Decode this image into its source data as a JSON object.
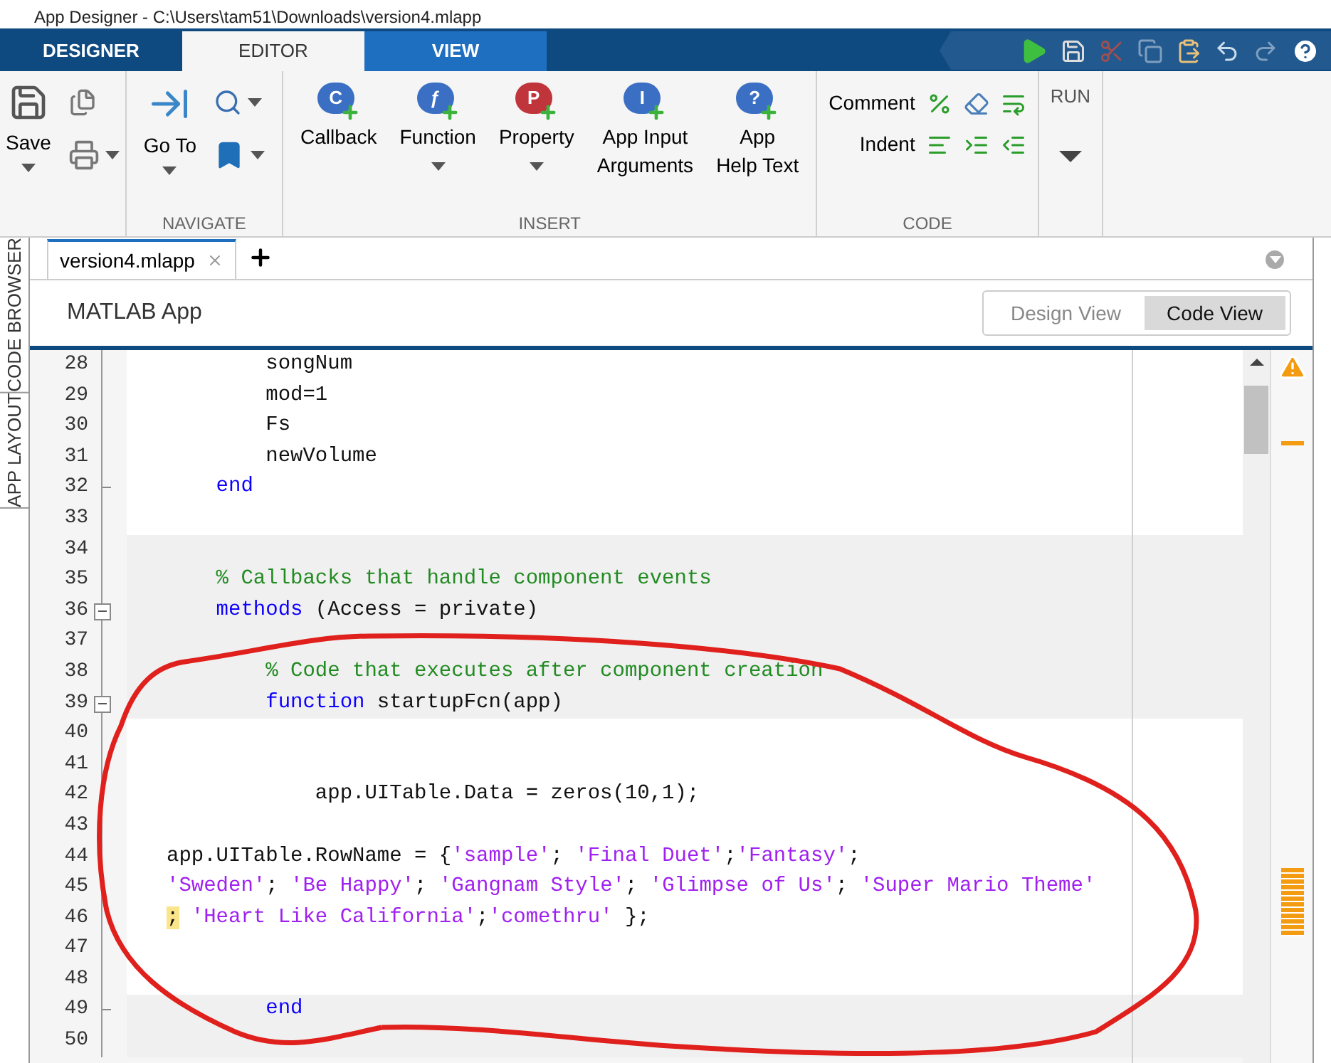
{
  "window": {
    "title": "App Designer - C:\\Users\\tam51\\Downloads\\version4.mlapp"
  },
  "ribbon_tabs": [
    {
      "label": "DESIGNER",
      "selected": false
    },
    {
      "label": "EDITOR",
      "selected": true
    },
    {
      "label": "VIEW",
      "selected": false
    }
  ],
  "ribbon_groups": [
    {
      "kind": "file",
      "buttons": [
        {
          "label": "Save",
          "dropdown": true
        }
      ]
    },
    {
      "kind": "navigate",
      "label": "NAVIGATE",
      "buttons": [
        {
          "label": "Go To",
          "dropdown": true
        }
      ]
    },
    {
      "kind": "insert",
      "label": "INSERT",
      "buttons": [
        {
          "label": "Callback",
          "glyph": "C",
          "color": "#3b6fc4",
          "dropdown": false
        },
        {
          "label": "Function",
          "glyph": "ƒ",
          "color": "#3b6fc4",
          "dropdown": true
        },
        {
          "label": "Property",
          "glyph": "P",
          "color": "#c0343c",
          "dropdown": true
        },
        {
          "label": "App Input\nArguments",
          "glyph": "I",
          "color": "#3b6fc4",
          "dropdown": false
        },
        {
          "label": "App\nHelp Text",
          "glyph": "?",
          "color": "#3b6fc4",
          "dropdown": false
        }
      ]
    },
    {
      "kind": "code",
      "label": "CODE",
      "buttons": [
        {
          "label": "Comment"
        },
        {
          "label": "Indent"
        }
      ]
    },
    {
      "kind": "run",
      "buttons": [
        {
          "label": "RUN",
          "dropdown": true
        }
      ]
    }
  ],
  "document_tabs": [
    {
      "label": "version4.mlapp",
      "selected": true
    }
  ],
  "header": {
    "title": "MATLAB App",
    "views": [
      {
        "label": "Design View",
        "selected": false
      },
      {
        "label": "Code View",
        "selected": true
      }
    ]
  },
  "side_tabs": [
    "CODE BROWSER",
    "APP LAYOUT"
  ],
  "code_lines": [
    {
      "n": "28",
      "editable": true,
      "segments": [
        {
          "kind": "plain",
          "text": "        songNum"
        }
      ]
    },
    {
      "n": "29",
      "editable": true,
      "segments": [
        {
          "kind": "plain",
          "text": "        mod=1"
        }
      ]
    },
    {
      "n": "30",
      "editable": true,
      "segments": [
        {
          "kind": "plain",
          "text": "        Fs"
        }
      ]
    },
    {
      "n": "31",
      "editable": true,
      "segments": [
        {
          "kind": "plain",
          "text": "        newVolume"
        }
      ]
    },
    {
      "n": "32",
      "editable": true,
      "kind": "fold_end",
      "segments": [
        {
          "kind": "keyword",
          "text": "    end"
        }
      ]
    },
    {
      "n": "33",
      "editable": true
    },
    {
      "n": "34",
      "editable": false
    },
    {
      "n": "35",
      "editable": false,
      "segments": [
        {
          "kind": "comment",
          "text": "    % Callbacks that handle component events"
        }
      ]
    },
    {
      "n": "36",
      "editable": false,
      "kind": "fold_start",
      "segments": [
        {
          "kind": "keyword",
          "text": "    methods"
        },
        {
          "kind": "plain",
          "text": " (Access = private)"
        }
      ]
    },
    {
      "n": "37",
      "editable": false
    },
    {
      "n": "38",
      "editable": false,
      "segments": [
        {
          "kind": "comment",
          "text": "        % Code that executes after component creation"
        }
      ]
    },
    {
      "n": "39",
      "editable": false,
      "kind": "fold_start",
      "segments": [
        {
          "kind": "keyword",
          "text": "        function"
        },
        {
          "kind": "plain",
          "text": " startupFcn(app)"
        }
      ]
    },
    {
      "n": "40",
      "editable": true
    },
    {
      "n": "41",
      "editable": true
    },
    {
      "n": "42",
      "editable": true,
      "segments": [
        {
          "kind": "plain",
          "text": "            app.UITable.Data = zeros(10,1);"
        }
      ]
    },
    {
      "n": "43",
      "editable": true
    },
    {
      "n": "44",
      "editable": true,
      "segments": [
        {
          "kind": "plain",
          "text": "app.UITable.RowName = {"
        },
        {
          "kind": "string",
          "text": "'sample'"
        },
        {
          "kind": "plain",
          "text": "; "
        },
        {
          "kind": "string",
          "text": "'Final Duet'"
        },
        {
          "kind": "plain",
          "text": ";"
        },
        {
          "kind": "string",
          "text": "'Fantasy'"
        },
        {
          "kind": "plain",
          "text": ";"
        }
      ]
    },
    {
      "n": "45",
      "editable": true,
      "segments": [
        {
          "kind": "string",
          "text": "'Sweden'"
        },
        {
          "kind": "plain",
          "text": "; "
        },
        {
          "kind": "string",
          "text": "'Be Happy'"
        },
        {
          "kind": "plain",
          "text": "; "
        },
        {
          "kind": "string",
          "text": "'Gangnam Style'"
        },
        {
          "kind": "plain",
          "text": "; "
        },
        {
          "kind": "string",
          "text": "'Glimpse of Us'"
        },
        {
          "kind": "plain",
          "text": "; "
        },
        {
          "kind": "string",
          "text": "'Super Mario Theme'"
        }
      ]
    },
    {
      "n": "46",
      "editable": true,
      "segments": [
        {
          "kind": "marked",
          "text": ";"
        },
        {
          "kind": "string",
          "text": " 'Heart Like California'"
        },
        {
          "kind": "plain",
          "text": ";"
        },
        {
          "kind": "string",
          "text": "'comethru'"
        },
        {
          "kind": "plain",
          "text": " };"
        }
      ]
    },
    {
      "n": "47",
      "editable": true
    },
    {
      "n": "48",
      "editable": true
    },
    {
      "n": "49",
      "editable": false,
      "kind": "fold_end",
      "segments": [
        {
          "kind": "keyword",
          "text": "        end"
        }
      ]
    },
    {
      "n": "50",
      "editable": false
    }
  ]
}
